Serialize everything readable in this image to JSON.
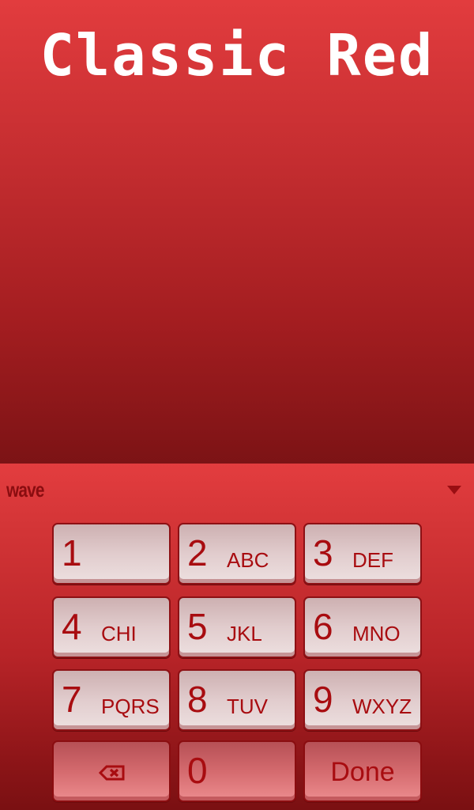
{
  "theme": {
    "title": "Classic Red",
    "accent": "#a80c10",
    "background_top": "#e23c3e",
    "background_bottom": "#7c1315"
  },
  "keyboard": {
    "brand_logo": "wave",
    "collapse_icon": "chevron-down-icon",
    "keys": [
      {
        "num": "1",
        "letters": ""
      },
      {
        "num": "2",
        "letters": "ABC"
      },
      {
        "num": "3",
        "letters": "DEF"
      },
      {
        "num": "4",
        "letters": "CHI"
      },
      {
        "num": "5",
        "letters": "JKL"
      },
      {
        "num": "6",
        "letters": "MNO"
      },
      {
        "num": "7",
        "letters": "PQRS"
      },
      {
        "num": "8",
        "letters": "TUV"
      },
      {
        "num": "9",
        "letters": "WXYZ"
      }
    ],
    "backspace_icon": "backspace-icon",
    "zero": "0",
    "done_label": "Done"
  }
}
